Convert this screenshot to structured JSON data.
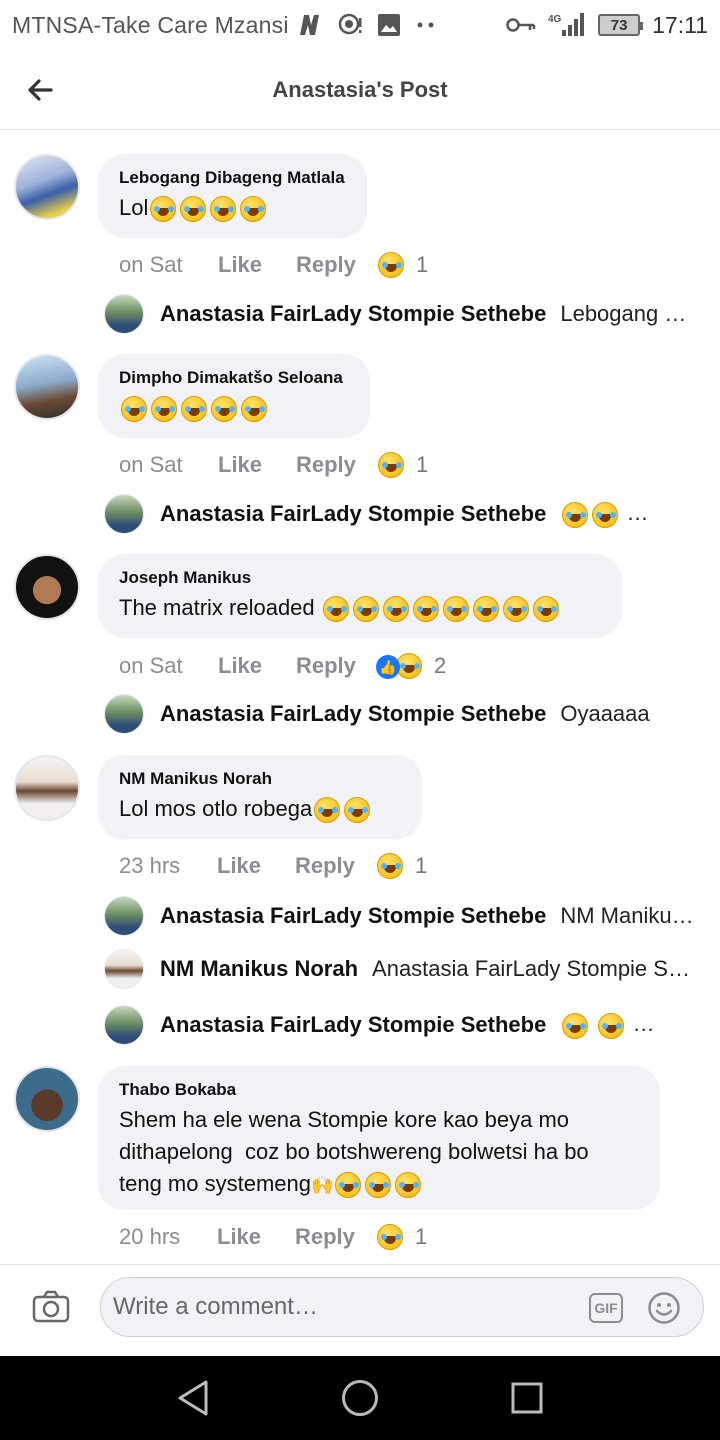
{
  "status_bar": {
    "carrier": "MTNSA-Take Care Mzansi",
    "network": "4G",
    "battery": "73",
    "time": "17:11"
  },
  "header": {
    "title": "Anastasia's Post"
  },
  "comments": [
    {
      "author": "Lebogang Dibageng Matlala",
      "text": "Lol",
      "emoji_count": 4,
      "time": "on Sat",
      "like": "Like",
      "reply": "Reply",
      "reaction_count": "1",
      "replies": [
        {
          "name": "Anastasia FairLady Stompie Sethebe",
          "text": "Lebogang Dibageng Matlala"
        }
      ]
    },
    {
      "author": "Dimpho Dimakatšo Seloana",
      "text": "",
      "emoji_count": 5,
      "time": "on Sat",
      "like": "Like",
      "reply": "Reply",
      "reaction_count": "1",
      "replies": [
        {
          "name": "Anastasia FairLady Stompie Sethebe",
          "text": ""
        }
      ]
    },
    {
      "author": "Joseph Manikus",
      "text": "The matrix reloaded ",
      "emoji_count": 8,
      "time": "on Sat",
      "like": "Like",
      "reply": "Reply",
      "reaction_count": "2",
      "replies": [
        {
          "name": "Anastasia FairLady Stompie Sethebe",
          "text": "Oyaaaaa"
        }
      ]
    },
    {
      "author": "NM Manikus Norah",
      "text": "Lol mos otlo robega",
      "emoji_count": 2,
      "time": "23 hrs",
      "like": "Like",
      "reply": "Reply",
      "reaction_count": "1",
      "replies": [
        {
          "name": "Anastasia FairLady Stompie Sethebe",
          "text": "NM Manikus Norah"
        },
        {
          "name": "NM Manikus Norah",
          "text": "Anastasia FairLady Stompie Sethebe"
        },
        {
          "name": "Anastasia FairLady Stompie Sethebe",
          "text": ""
        }
      ]
    },
    {
      "author": "Thabo Bokaba",
      "text": "Shem ha ele wena Stompie kore kao beya mo\ndithapelong  coz bo botshwereng bolwetsi ha bo\nteng mo systemeng",
      "emoji_count": 3,
      "time": "20 hrs",
      "like": "Like",
      "reply": "Reply",
      "reaction_count": "1",
      "replies": []
    }
  ],
  "composer": {
    "placeholder": "Write a comment…",
    "gif_label": "GIF"
  },
  "colors": {
    "bubble": "#f0f2f5",
    "meta_text": "#8a8d91",
    "like_blue": "#1877f2"
  }
}
